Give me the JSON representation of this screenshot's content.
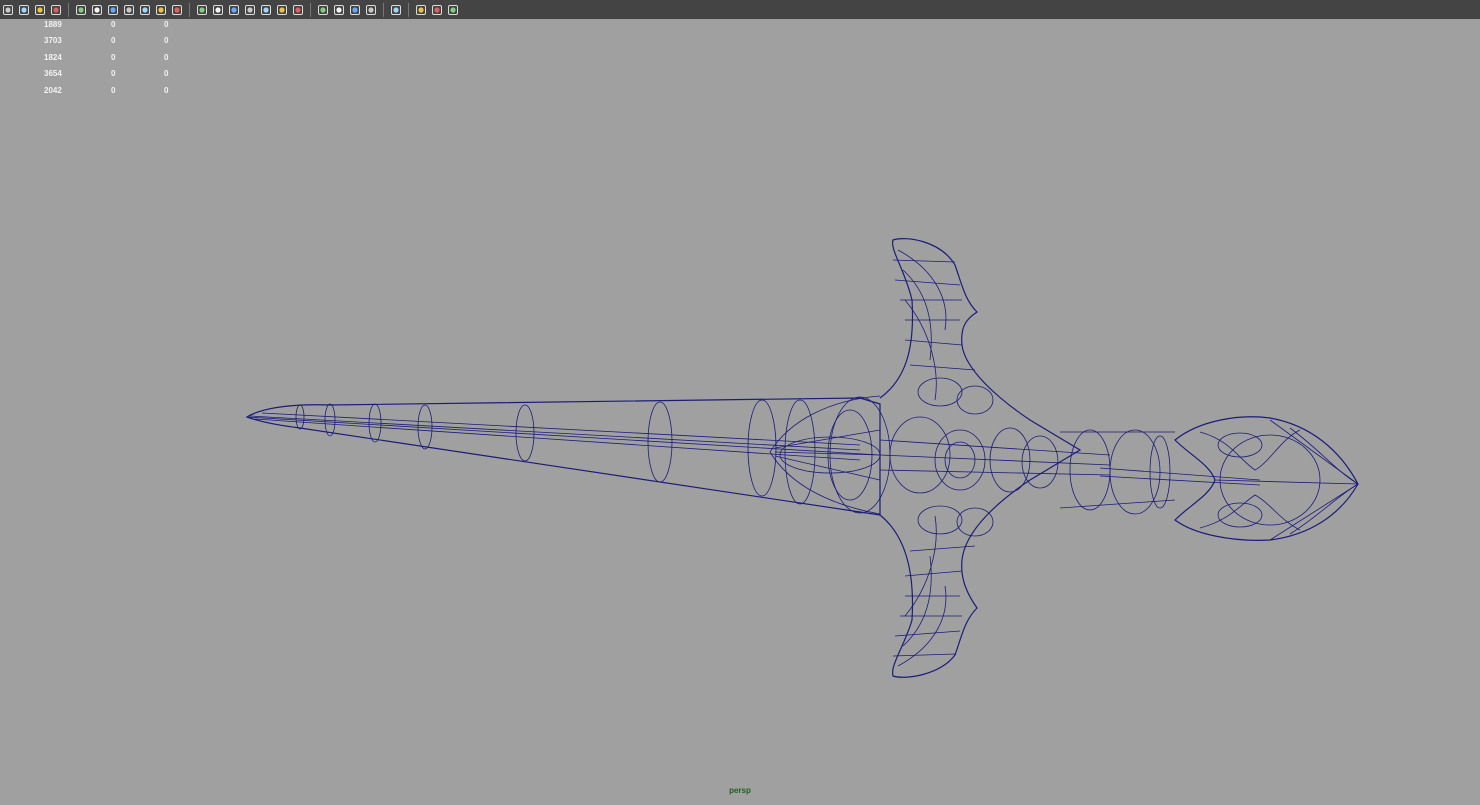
{
  "toolbar": {
    "items": [
      {
        "name": "select-camera-icon"
      },
      {
        "name": "camera-attributes-icon"
      },
      {
        "name": "bookmarks-icon"
      },
      {
        "name": "image-plane-icon"
      },
      {
        "sep": true
      },
      {
        "name": "grid-icon"
      },
      {
        "name": "film-gate-icon"
      },
      {
        "name": "resolution-gate-icon"
      },
      {
        "name": "gate-mask-icon"
      },
      {
        "name": "field-chart-icon"
      },
      {
        "name": "safe-action-icon"
      },
      {
        "name": "safe-title-icon"
      },
      {
        "sep": true
      },
      {
        "name": "wireframe-icon"
      },
      {
        "name": "smooth-shade-icon"
      },
      {
        "name": "wireframe-on-shaded-icon"
      },
      {
        "name": "xray-icon"
      },
      {
        "name": "textured-icon"
      },
      {
        "name": "use-all-lights-icon"
      },
      {
        "name": "shadows-icon"
      },
      {
        "sep": true
      },
      {
        "name": "screen-space-ao-icon"
      },
      {
        "name": "motion-blur-icon"
      },
      {
        "name": "anti-aliasing-icon"
      },
      {
        "name": "depth-of-field-icon"
      },
      {
        "sep": true
      },
      {
        "name": "isolate-select-icon"
      },
      {
        "sep": true
      },
      {
        "name": "xray-joints-icon"
      },
      {
        "name": "xray-active-components-icon"
      },
      {
        "name": "share-icon"
      }
    ]
  },
  "hud": {
    "rows": [
      [
        "1889",
        "0",
        "0"
      ],
      [
        "3703",
        "0",
        "0"
      ],
      [
        "1824",
        "0",
        "0"
      ],
      [
        "3654",
        "0",
        "0"
      ],
      [
        "2042",
        "0",
        "0"
      ]
    ]
  },
  "viewport": {
    "camera_label": "persp",
    "background_color": "#a0a0a0",
    "wire_color": "#1c1c7a",
    "display_mode": "wireframe"
  }
}
